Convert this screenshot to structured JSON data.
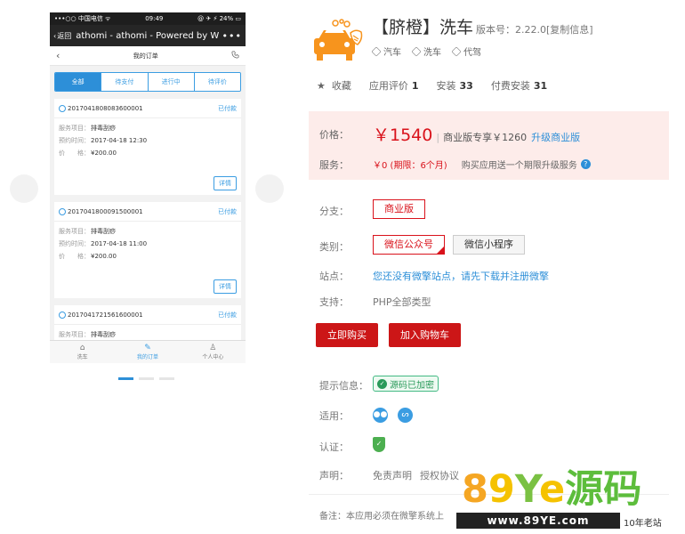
{
  "phone": {
    "status": {
      "carrier": "•••○○ 中国电信 ᯤ",
      "time": "09:49",
      "battery": "@ ✈ ⚡ 24% ▭"
    },
    "nav": {
      "back": "返回",
      "title": "athomi - athomi - Powered by W...",
      "more": "•••"
    },
    "appbar": {
      "title": "我的订单"
    },
    "tabs": [
      "全部",
      "待支付",
      "进行中",
      "待评价"
    ],
    "orders": [
      {
        "no": "2017041808083600001",
        "status": "已付款",
        "service_label": "服务项目：",
        "service": "排毒刮痧",
        "date_label": "预约时间：",
        "date": "2017-04-18 12:30",
        "price_label": "价　　格：",
        "price": "¥200.00",
        "detail": "详情"
      },
      {
        "no": "2017041800091500001",
        "status": "已付款",
        "service_label": "服务项目：",
        "service": "排毒刮痧",
        "date_label": "预约时间：",
        "date": "2017-04-18 11:00",
        "price_label": "价　　格：",
        "price": "¥200.00",
        "detail": "详情"
      },
      {
        "no": "2017041721561600001",
        "status": "已付款",
        "service_label": "服务项目：",
        "service": "排毒刮痧"
      }
    ],
    "footer": [
      {
        "label": "洗车",
        "icon": "home-icon"
      },
      {
        "label": "我的订单",
        "icon": "edit-icon"
      },
      {
        "label": "个人中心",
        "icon": "user-icon"
      }
    ]
  },
  "app": {
    "title": "【脐橙】洗车",
    "version": "版本号：2.22.0[复制信息]",
    "tags": [
      "汽车",
      "洗车",
      "代驾"
    ]
  },
  "stats": {
    "favorite": "收藏",
    "rating_label": "应用评价",
    "rating": "1",
    "install_label": "安装",
    "install": "33",
    "paid_label": "付费安装",
    "paid": "31"
  },
  "price": {
    "label": "价格：",
    "value": "￥1540",
    "sep": "|",
    "biz": "商业版专享￥1260",
    "upgrade": "升级商业版",
    "service_label": "服务：",
    "service_value": "￥0 (期限：6个月)",
    "service_note": "购买应用送一个期限升级服务"
  },
  "spec": {
    "branch_label": "分支：",
    "branch": "商业版",
    "category_label": "类别：",
    "category_1": "微信公众号",
    "category_2": "微信小程序",
    "site_label": "站点：",
    "site_link": "您还没有微擎站点，请先下载并注册微擎",
    "support_label": "支持：",
    "support": "PHP全部类型"
  },
  "buttons": {
    "buy": "立即购买",
    "cart": "加入购物车"
  },
  "info": {
    "hint_label": "提示信息：",
    "hint_badge": "源码已加密",
    "apply_label": "适用：",
    "cert_label": "认证：",
    "declare_label": "声明：",
    "disclaimer": "免责声明",
    "license": "授权协议"
  },
  "note": "备注：本应用必须在微擎系统上",
  "watermark": {
    "big_1": "8",
    "big_2": "9",
    "big_3": "Y",
    "big_4": "e",
    "big_5": "源码",
    "site": "www.89YE.com",
    "tag": "10年老站"
  },
  "colors": {
    "accent_red": "#d9121b",
    "link_blue": "#2d8fd8",
    "price_bg": "#fdecea"
  }
}
